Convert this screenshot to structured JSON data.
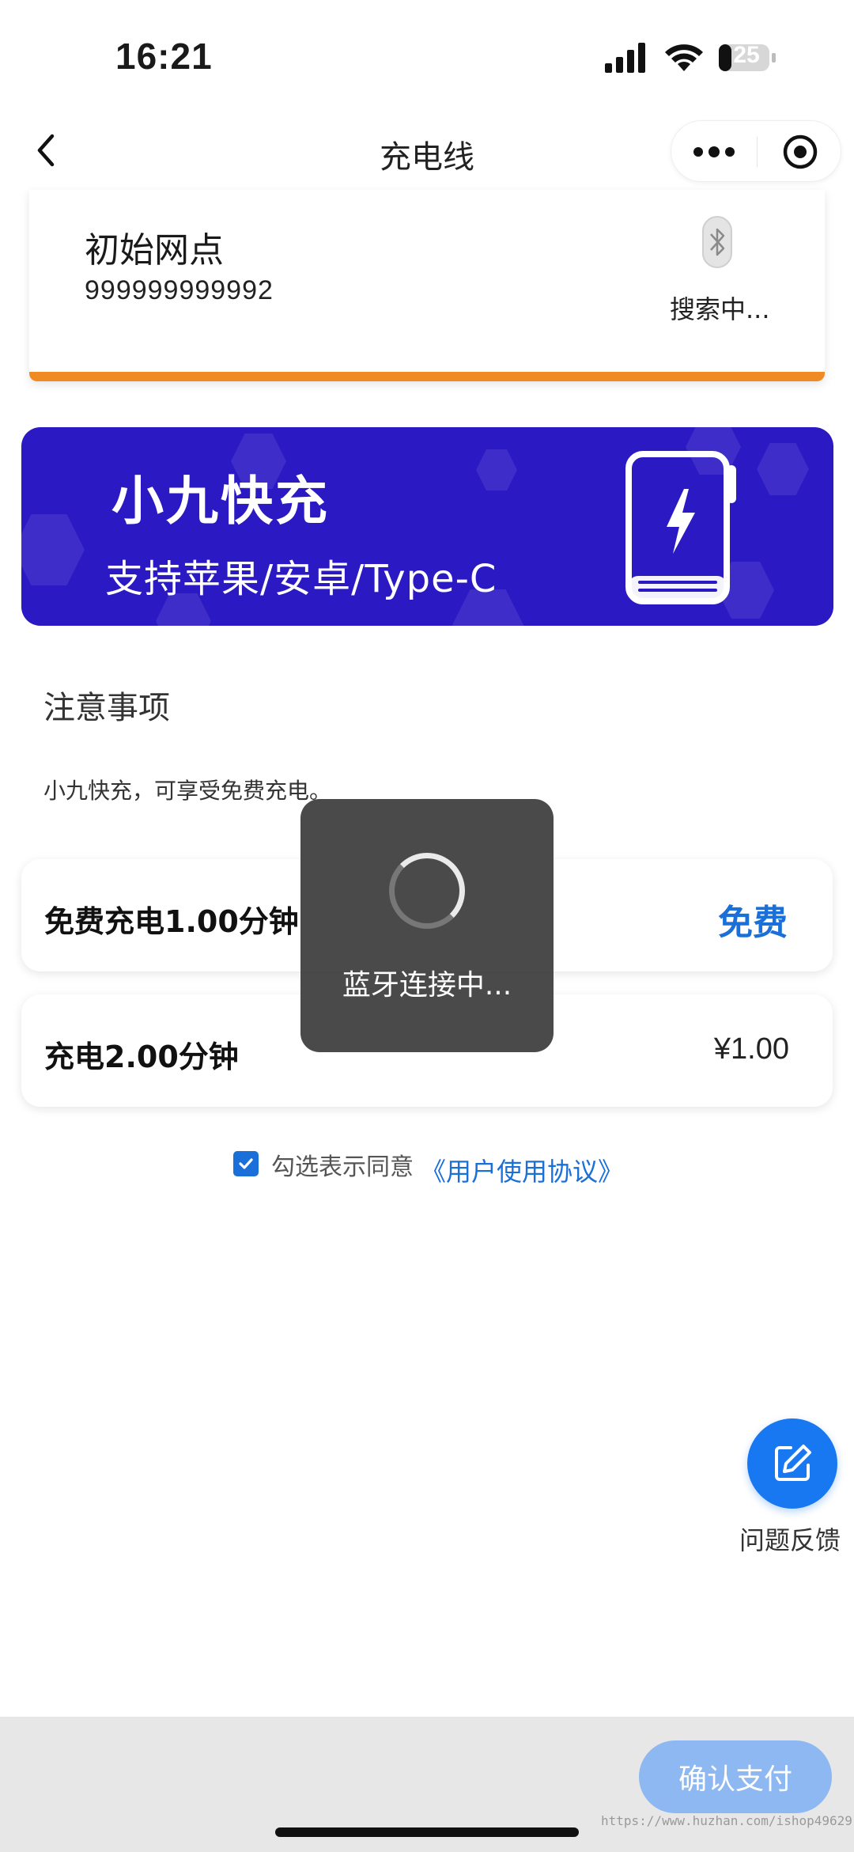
{
  "status_bar": {
    "time": "16:21",
    "battery": "25"
  },
  "nav": {
    "title": "充电线"
  },
  "device": {
    "name": "初始网点",
    "id": "999999999992",
    "bluetooth_status": "搜索中..."
  },
  "banner": {
    "title": "小九快充",
    "subtitle": "支持苹果/安卓/Type-C"
  },
  "notes": {
    "title": "注意事项",
    "text": "小九快充，可享受免费充电。"
  },
  "options": [
    {
      "label": "免费充电1.00分钟",
      "price": "免费"
    },
    {
      "label": "充电2.00分钟",
      "price": "¥1.00"
    }
  ],
  "agreement": {
    "checked": true,
    "text": "勾选表示同意",
    "link": "《用户使用协议》"
  },
  "toast": {
    "text": "蓝牙连接中..."
  },
  "feedback": {
    "label": "问题反馈"
  },
  "footer": {
    "pay_label": "确认支付",
    "watermark": "https://www.huzhan.com/ishop49629"
  },
  "colors": {
    "accent": "#1a6fd8",
    "banner": "#2b19c3",
    "card_border": "#f08a24",
    "pay_button": "#8db8f2"
  }
}
